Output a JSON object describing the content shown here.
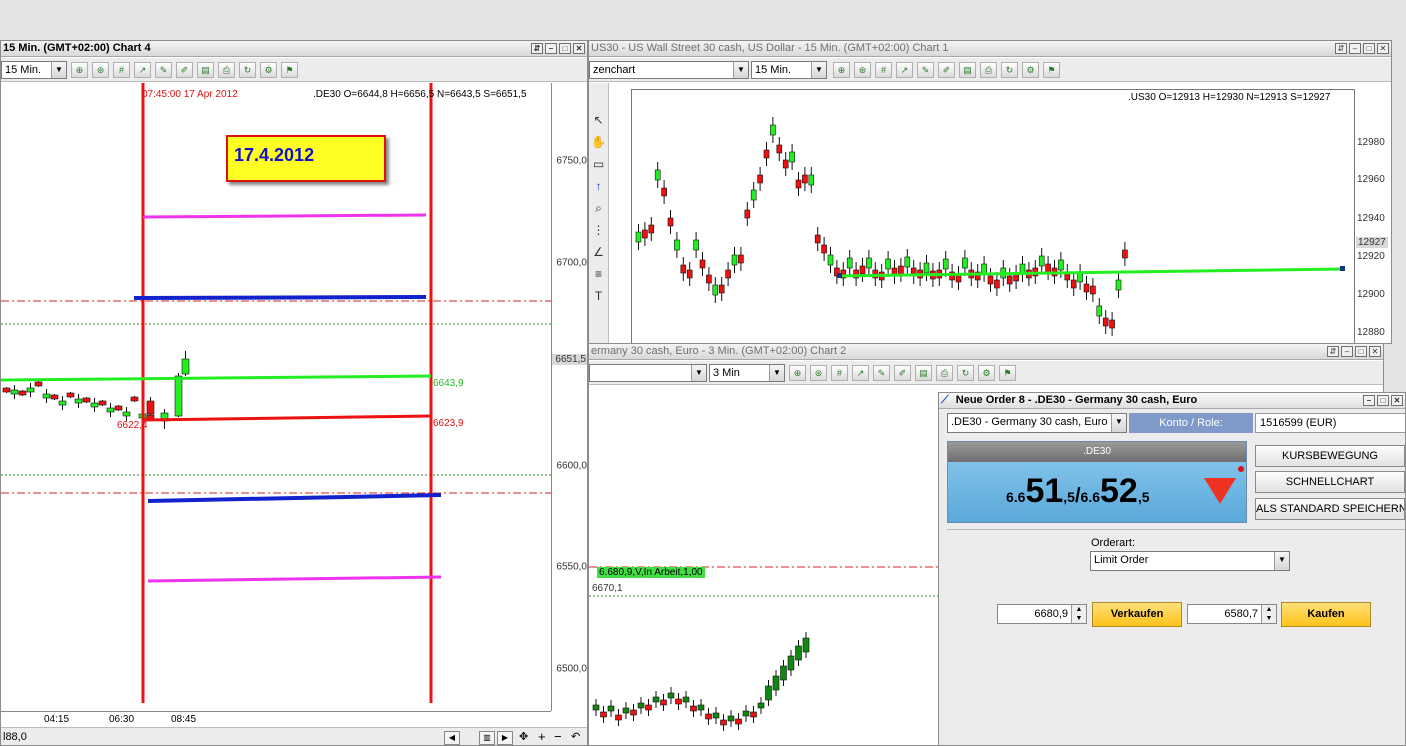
{
  "chart4": {
    "title": "15 Min. (GMT+02:00)   Chart 4",
    "timeframe": "15 Min.",
    "ohlc": ".DE30 O=6644,8 H=6656,5 N=6643,5 S=6651,5",
    "overlap_text": "07:45:00 17 Apr 2012",
    "date_box": "17.4.2012",
    "last_price": "6651,5",
    "level_green": "6643,9",
    "level_red_right": "6623,9",
    "level_red_left": "6622,4",
    "y_labels": [
      "6750,0",
      "6700,0",
      "6650,0",
      "6600,0",
      "6550,0",
      "6500,0"
    ],
    "x_labels": [
      "04:15",
      "06:30",
      "08:45"
    ],
    "status_text": "l88,0"
  },
  "chart1": {
    "title": "US30 - US Wall Street 30 cash, US Dollar - 15 Min. (GMT+02:00)   Chart 1",
    "type_label": "zenchart",
    "timeframe": "15 Min.",
    "ohlc": ".US30 O=12913 H=12930 N=12913 S=12927",
    "last_price": "12927",
    "y_labels": [
      "12980",
      "12960",
      "12940",
      "12920",
      "12900",
      "12880"
    ]
  },
  "chart2": {
    "title": "ermany 30 cash, Euro - 3 Min. (GMT+02:00)   Chart 2",
    "timeframe": "3 Min",
    "order_label": "6.680,9,V,In Arbeit,1,00",
    "level_label": "6670,1"
  },
  "order": {
    "title": "Neue Order 8 - .DE30 - Germany 30 cash, Euro",
    "instrument": ".DE30 - Germany 30 cash, Euro",
    "konto_label": "Konto / Role:",
    "konto_value": "1516599 (EUR)",
    "symbol": ".DE30",
    "bid_prefix": "6.6",
    "bid_big": "51",
    "bid_sub": ",5",
    "sep": "/",
    "ask_prefix": "6.6",
    "ask_big": "52",
    "ask_sub": ",5",
    "btn_kurs": "KURSBEWEGUNG",
    "btn_schnell": "SCHNELLCHART",
    "btn_standard": "ALS STANDARD SPEICHERN",
    "orderart_label": "Orderart:",
    "orderart_value": "Limit Order",
    "sell_price": "6680,9",
    "sell_label": "Verkaufen",
    "buy_price": "6580,7",
    "buy_label": "Kaufen"
  },
  "colors": {
    "up": "#22ee22",
    "down": "#ee1111",
    "dark_up": "#118811",
    "magenta": "#ee33ee",
    "blue": "#1122cc",
    "accent": "#ffcc33"
  }
}
